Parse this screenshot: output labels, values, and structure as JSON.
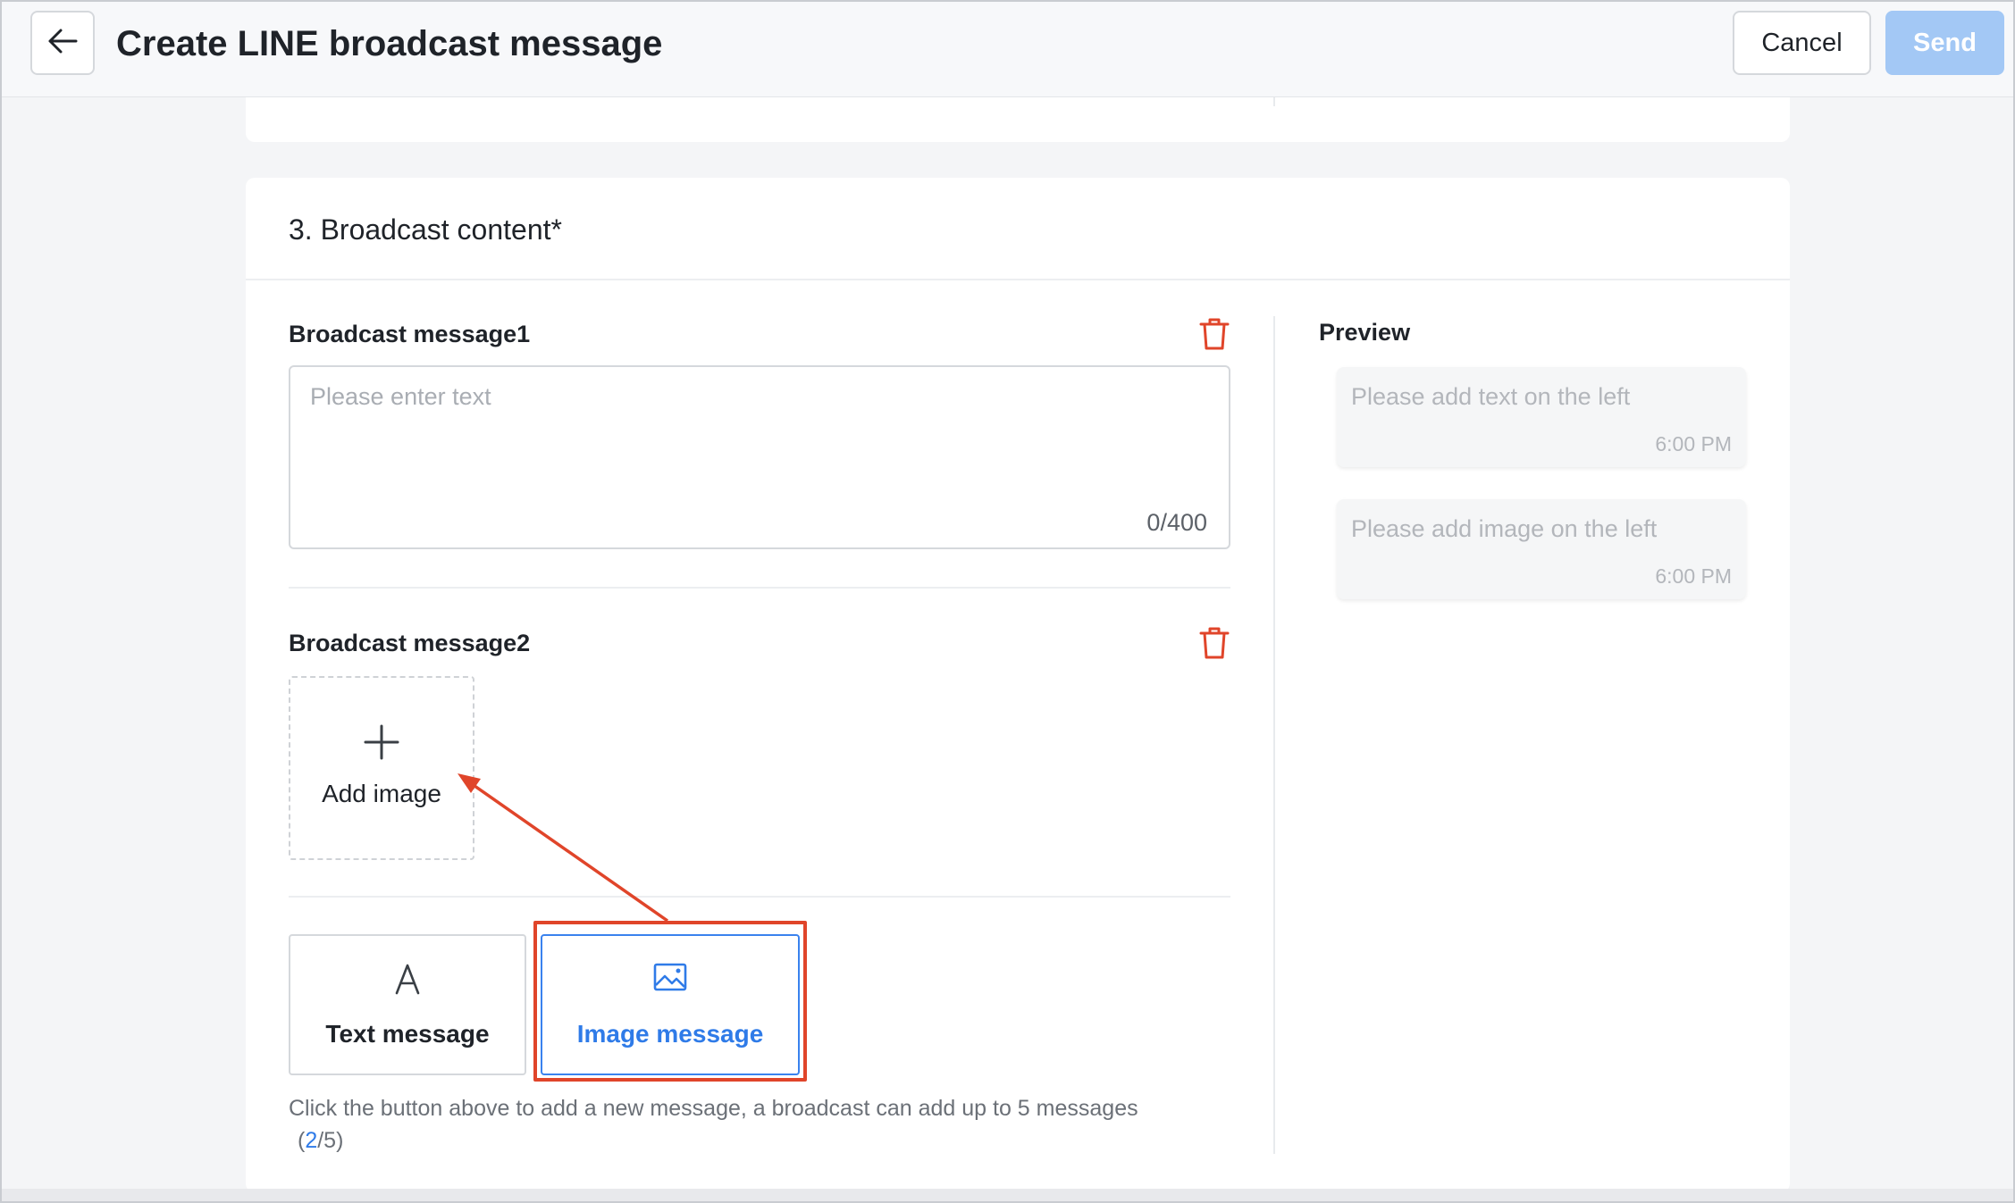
{
  "header": {
    "title": "Create LINE broadcast message",
    "back_icon": "arrow-left-icon",
    "cancel_label": "Cancel",
    "send_label": "Send"
  },
  "section": {
    "title": "3. Broadcast content*"
  },
  "messages": [
    {
      "label": "Broadcast message1",
      "placeholder": "Please enter text",
      "counter": "0/400",
      "delete_icon": "trash-icon"
    },
    {
      "label": "Broadcast message2",
      "add_image_label": "Add image",
      "delete_icon": "trash-icon"
    }
  ],
  "add_buttons": {
    "text_label": "Text message",
    "text_icon": "letter-a-icon",
    "image_label": "Image message",
    "image_icon": "image-icon"
  },
  "hint": {
    "text": "Click the button above to add a new message, a broadcast can add up to 5 messages",
    "open": "(",
    "count_now": "2",
    "count_rest": "/5)"
  },
  "preview": {
    "title": "Preview",
    "bubbles": [
      {
        "text": "Please add text on the left",
        "time": "6:00 PM"
      },
      {
        "text": "Please add image on the left",
        "time": "6:00 PM"
      }
    ]
  },
  "colors": {
    "accent": "#2f7be8",
    "send_disabled": "#a3c8f5",
    "danger": "#e0452a",
    "annotation": "#e0452a"
  }
}
